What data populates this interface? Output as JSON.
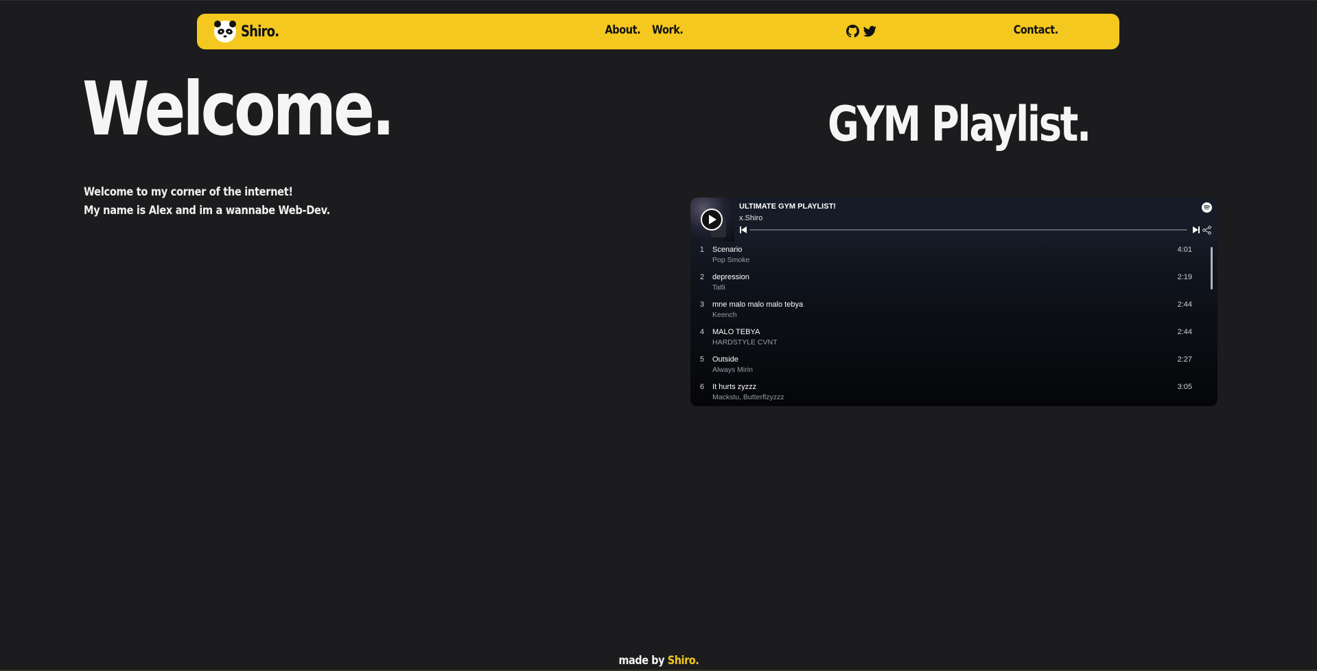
{
  "nav": {
    "brand": "Shiro.",
    "links": [
      "About.",
      "Work."
    ],
    "contact": "Contact.",
    "socials": [
      "github-icon",
      "twitter-icon"
    ]
  },
  "hero": {
    "title": "Welcome.",
    "line1": "Welcome to my corner of the internet!",
    "line2": "My name is Alex and im a wannabe Web-Dev."
  },
  "playlist_section": {
    "title": "GYM Playlist."
  },
  "player": {
    "name": "ULTIMATE GYM PLAYLIST!",
    "owner": "x.Shiro",
    "tracks": [
      {
        "num": "1",
        "name": "Scenario",
        "artist": "Pop Smoke",
        "duration": "4:01"
      },
      {
        "num": "2",
        "name": "depression",
        "artist": "Tatli",
        "duration": "2:19"
      },
      {
        "num": "3",
        "name": "mne malo malo malo tebya",
        "artist": "Keench",
        "duration": "2:44"
      },
      {
        "num": "4",
        "name": "MALO TEBYA",
        "artist": "HARDSTYLE CVNT",
        "duration": "2:44"
      },
      {
        "num": "5",
        "name": "Outside",
        "artist": "Always Mirin",
        "duration": "2:27"
      },
      {
        "num": "6",
        "name": "It hurts zyzzz",
        "artist": "Mackstu, Butterflzyzzz",
        "duration": "3:05"
      }
    ]
  },
  "footer": {
    "prefix": "made by ",
    "brand": "Shiro."
  },
  "colors": {
    "accent": "#f4c81f",
    "background": "#1c1c1e"
  }
}
